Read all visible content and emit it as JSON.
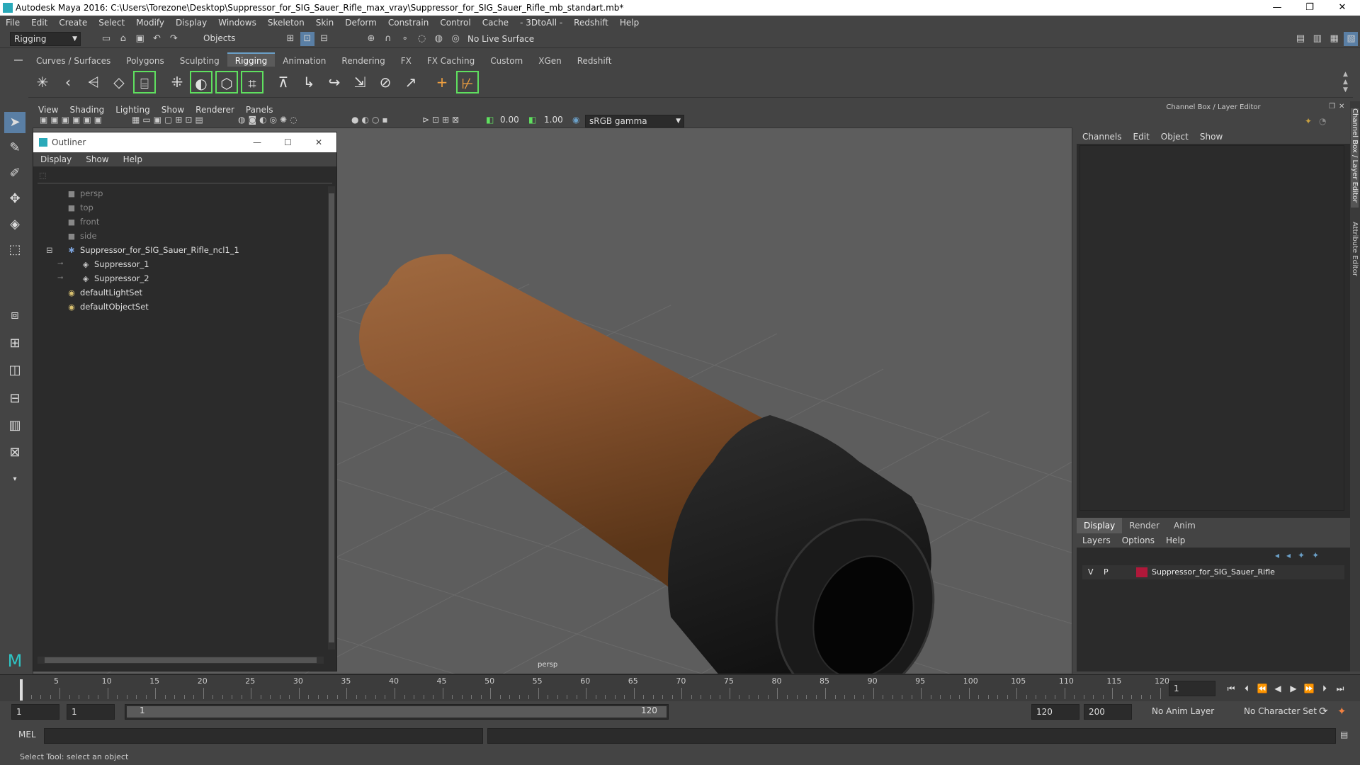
{
  "titlebar": {
    "title": "Autodesk Maya 2016: C:\\Users\\Torezone\\Desktop\\Suppressor_for_SIG_Sauer_Rifle_max_vray\\Suppressor_for_SIG_Sauer_Rifle_mb_standart.mb*",
    "minimize": "—",
    "restore": "❐",
    "close": "✕"
  },
  "menubar": [
    "File",
    "Edit",
    "Create",
    "Select",
    "Modify",
    "Display",
    "Windows",
    "Skeleton",
    "Skin",
    "Deform",
    "Constrain",
    "Control",
    "Cache",
    "- 3DtoAll -",
    "Redshift",
    "Help"
  ],
  "statusline": {
    "mode": "Rigging",
    "selection_mode": "Objects",
    "live_surface": "No Live Surface"
  },
  "shelf_tabs": [
    {
      "label": "Curves / Surfaces"
    },
    {
      "label": "Polygons"
    },
    {
      "label": "Sculpting"
    },
    {
      "label": "Rigging",
      "active": true
    },
    {
      "label": "Animation"
    },
    {
      "label": "Rendering"
    },
    {
      "label": "FX"
    },
    {
      "label": "FX Caching"
    },
    {
      "label": "Custom"
    },
    {
      "label": "XGen"
    },
    {
      "label": "Redshift"
    }
  ],
  "viewport_menu": [
    "View",
    "Shading",
    "Lighting",
    "Show",
    "Renderer",
    "Panels"
  ],
  "viewport_toolbar": {
    "exposure": "0.00",
    "gamma": "1.00",
    "color_space": "sRGB gamma"
  },
  "viewport": {
    "camera_label": "persp",
    "object_colors": {
      "body": "#8a5530",
      "cap": "#1a1a1a"
    }
  },
  "outliner": {
    "title": "Outliner",
    "menu": [
      "Display",
      "Show",
      "Help"
    ],
    "items": [
      {
        "label": "persp",
        "icon": "camera-icon",
        "dim": true,
        "indent": 0
      },
      {
        "label": "top",
        "icon": "camera-icon",
        "dim": true,
        "indent": 0
      },
      {
        "label": "front",
        "icon": "camera-icon",
        "dim": true,
        "indent": 0
      },
      {
        "label": "side",
        "icon": "camera-icon",
        "dim": true,
        "indent": 0
      },
      {
        "label": "Suppressor_for_SIG_Sauer_Rifle_ncl1_1",
        "icon": "group-icon",
        "dim": false,
        "indent": 0,
        "expanded": true
      },
      {
        "label": "Suppressor_1",
        "icon": "mesh-icon",
        "dim": false,
        "indent": 1
      },
      {
        "label": "Suppressor_2",
        "icon": "mesh-icon",
        "dim": false,
        "indent": 1
      },
      {
        "label": "defaultLightSet",
        "icon": "set-icon",
        "dim": false,
        "indent": 0
      },
      {
        "label": "defaultObjectSet",
        "icon": "set-icon",
        "dim": false,
        "indent": 0
      }
    ]
  },
  "channel_box": {
    "title": "Channel Box / Layer Editor",
    "menu": [
      "Channels",
      "Edit",
      "Object",
      "Show"
    ],
    "layer_tabs": [
      {
        "label": "Display",
        "active": true
      },
      {
        "label": "Render"
      },
      {
        "label": "Anim"
      }
    ],
    "layer_menu": [
      "Layers",
      "Options",
      "Help"
    ],
    "layer": {
      "v": "V",
      "p": "P",
      "name": "Suppressor_for_SIG_Sauer_Rifle",
      "color": "#b0183a"
    }
  },
  "side_tabs": [
    "Channel Box / Layer Editor",
    "Attribute Editor"
  ],
  "timeline": {
    "ticks": [
      5,
      10,
      15,
      20,
      25,
      30,
      35,
      40,
      45,
      50,
      55,
      60,
      65,
      70,
      75,
      80,
      85,
      90,
      95,
      100,
      105,
      110,
      115,
      120
    ],
    "start": 1,
    "end": 120,
    "current_frame": "1"
  },
  "range": {
    "start_time": "1",
    "playback_start": "1",
    "slider_start": "1",
    "slider_end": "120",
    "playback_end": "120",
    "end_time": "200",
    "anim_layer": "No Anim Layer",
    "character_set": "No Character Set"
  },
  "cmdline": {
    "lang": "MEL"
  },
  "helpline": {
    "text": "Select Tool: select an object"
  }
}
